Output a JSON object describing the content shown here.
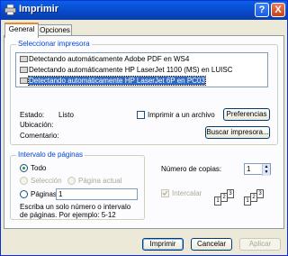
{
  "window": {
    "title": "Imprimir",
    "help_btn": "?",
    "close_btn": "X"
  },
  "tabs": [
    {
      "label": "General"
    },
    {
      "label": "Opciones"
    }
  ],
  "printer_group": {
    "label": "Seleccionar impresora",
    "printers": [
      {
        "label": "Detectando automáticamente Adobe PDF en WS4"
      },
      {
        "label": "Detectando automáticamente HP LaserJet 1100 (MS) en LUISC"
      },
      {
        "label": "Detectando automáticamente HP LaserJet 6P en PC03"
      }
    ],
    "status_label": "Estado:",
    "status_value": "Listo",
    "location_label": "Ubicación:",
    "comment_label": "Comentario:",
    "print_to_file": "Imprimir a un archivo",
    "preferences_btn": "Preferencias",
    "find_printer_btn": "Buscar impresora..."
  },
  "range_group": {
    "label": "Intervalo de páginas",
    "all": "Todo",
    "selection": "Selección",
    "current_page": "Página actual",
    "pages": "Páginas:",
    "pages_value": "1",
    "hint": "Escriba un solo número o intervalo de páginas. Por ejemplo: 5-12"
  },
  "copies": {
    "label": "Número de copias:",
    "value": "1",
    "collate": "Intercalar",
    "collate_pages": [
      "1",
      "2",
      "3",
      "1",
      "2",
      "3"
    ]
  },
  "buttons": {
    "print": "Imprimir",
    "cancel": "Cancelar",
    "apply": "Aplicar"
  },
  "colors": {
    "accent": "#0046d5",
    "selection": "#316ac5",
    "titlebar": "#0848c8"
  }
}
